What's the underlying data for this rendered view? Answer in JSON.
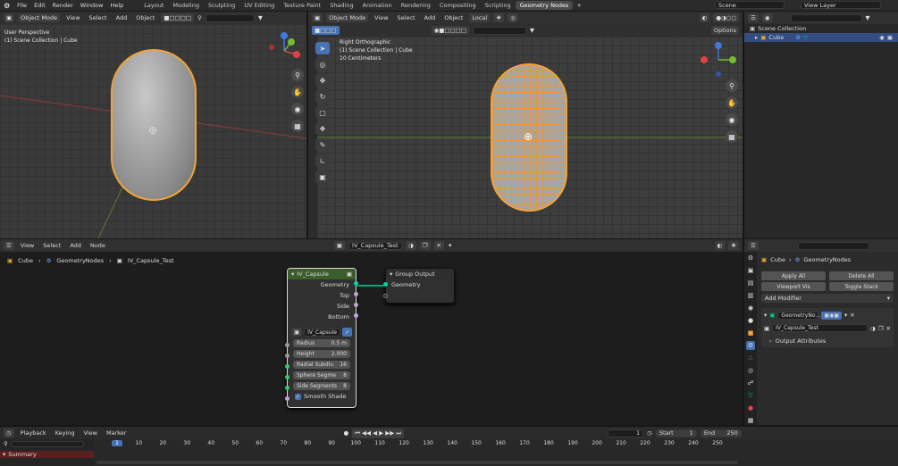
{
  "menubar": {
    "menus": [
      "File",
      "Edit",
      "Render",
      "Window",
      "Help"
    ],
    "workspaces": [
      "Layout",
      "Modeling",
      "Sculpting",
      "UV Editing",
      "Texture Paint",
      "Shading",
      "Animation",
      "Rendering",
      "Compositing",
      "Scripting",
      "Geometry Nodes"
    ],
    "active_workspace": "Geometry Nodes",
    "add_tab": "+",
    "scene": "Scene",
    "view_layer": "View Layer"
  },
  "viewport_left": {
    "mode": "Object Mode",
    "menus": [
      "View",
      "Select",
      "Add",
      "Object"
    ],
    "view_name": "User Perspective",
    "collection": "(1) Scene Collection | Cube"
  },
  "viewport_right": {
    "mode": "Object Mode",
    "menus": [
      "View",
      "Select",
      "Add",
      "Object"
    ],
    "orientation": "Local",
    "options": "Options",
    "view_name": "Right Orthographic",
    "collection": "(1) Scene Collection | Cube",
    "scale": "10 Centimeters"
  },
  "outliner": {
    "root": "Scene Collection",
    "item": "Cube"
  },
  "node_editor": {
    "menus": [
      "View",
      "Select",
      "Add",
      "Node"
    ],
    "tree_name": "IV_Capsule_Test",
    "breadcrumb": [
      "Cube",
      "GeometryNodes",
      "IV_Capsule_Test"
    ],
    "group_node": {
      "title": "IV_Capsule",
      "outputs": [
        "Geometry",
        "Top",
        "Side",
        "Bottom"
      ],
      "datablock": "IV_Capsule",
      "fields": [
        {
          "label": "Radius",
          "value": "0.5 m"
        },
        {
          "label": "Height",
          "value": "2.000"
        },
        {
          "label": "Radial Subdiv.",
          "value": "16"
        },
        {
          "label": "Sphere Segme",
          "value": "8"
        },
        {
          "label": "Side Segments",
          "value": "8"
        }
      ],
      "checkbox": "Smooth Shade"
    },
    "output_node": {
      "title": "Group Output",
      "inputs": [
        "Geometry"
      ]
    }
  },
  "properties": {
    "object": "Cube",
    "modifier_path": "GeometryNodes",
    "apply_all": "Apply All",
    "delete_all": "Delete All",
    "viewport_vis": "Viewport Vis",
    "toggle_stack": "Toggle Stack",
    "add_modifier": "Add Modifier",
    "modifier_name": "GeometryNo...",
    "node_group": "IV_Capsule_Test",
    "output_attributes": "Output Attributes"
  },
  "timeline": {
    "menus": [
      "Playback",
      "Keying",
      "View",
      "Marker"
    ],
    "current_frame": "1",
    "start_label": "Start",
    "start": "1",
    "end_label": "End",
    "end": "250",
    "summary": "Summary",
    "ticks": [
      "1",
      "10",
      "20",
      "30",
      "40",
      "50",
      "60",
      "70",
      "80",
      "90",
      "100",
      "110",
      "120",
      "130",
      "140",
      "150",
      "160",
      "170",
      "180",
      "190",
      "200",
      "210",
      "220",
      "230",
      "240",
      "250"
    ]
  },
  "colors": {
    "accent": "#4772b3",
    "selection_orange": "#f2a33a",
    "geometry_socket": "#00d6a3",
    "group_header": "#3b5c2b"
  }
}
